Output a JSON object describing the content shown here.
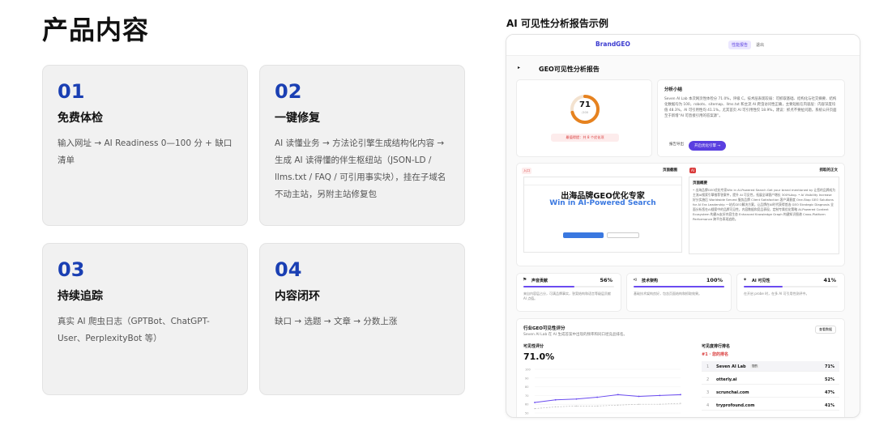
{
  "page_title": "产品内容",
  "cards": [
    {
      "num": "01",
      "title": "免费体检",
      "desc": "输入网址 → AI Readiness 0—100 分 + 缺口清单"
    },
    {
      "num": "02",
      "title": "一键修复",
      "desc": "AI 读懂业务 → 方法论引擎生成结构化内容 → 生成 AI 读得懂的伴生枢纽站（JSON-LD / llms.txt / FAQ / 可引用事实块），挂在子域名不动主站，另附主站修复包"
    },
    {
      "num": "03",
      "title": "持续追踪",
      "desc": "真实 AI 爬虫日志（GPTBot、ChatGPT-User、PerplexityBot 等）"
    },
    {
      "num": "04",
      "title": "内容闭环",
      "desc": "缺口 → 选题 → 文章 → 分数上涨"
    }
  ],
  "report": {
    "heading": "AI 可见性分析报告示例",
    "brand": "BrandGEO",
    "nav_btn1": "性能报告",
    "nav_btn2": "退出",
    "title": "GEO可见性分析报告",
    "score": "71",
    "score_sub": "/100",
    "score_badge": "最值得提：共 8 个优化项",
    "summary_title": "分析小结",
    "summary_text": "Seven AI Lab 本次网页性体检分 71.0%，评级 C。技术层表现较弱：可抓取基础、结构化与社交摘要、结构化数据均为 100，robots、sitemap、llms.txt 和主流 AI 爬虫访问性正确，主要短板在内容层：内容深度均值 48.3%，AI 可引用性均 41.1%，尤其首页 AI 可引用性仅 18.9%，建议：抓点不要扯问题，系统公开页面至于新增“AI 可直接引用的答案源”。",
    "btn_secondary": "报告导出",
    "btn_primary": "开启优化引擎 →",
    "preview_label_l": "页面截图",
    "preview_label_r": "抓取的正文",
    "tag_l": "入口",
    "tag_r": "AI",
    "hero_line1": "出海品牌GEO优化专家",
    "hero_line2": "Win in AI-Powered Search",
    "page_summary_title": "页面概要",
    "page_summary_text": "• 出海品牌GEO优化专家Win in AI-Powered Search Get your brand mentioned by 让您的品牌成为主流AI搜索引擎推荐答案中，提升 AI 可见性，拓展全球客户增长 300%Avg. • AI Visibility Increase 好分实施后 Worldwide Served 服务品牌 Client Satisfaction 客户满意度 One-Stop GEO Solutions for AI Era Leadership 一站式GEO解决方案，让品牌在AI时代获得首选 GEO Strategic Diagnosis 全面分析您在AI搜索中的品牌可见性，内容数据和竞品表现，定制专属优化策略 AI-Powered Content Ecosystem 构建AI友好内容生态 Enhanced Knowledge Graph 构建知识图谱 Cross-Platform Performance 跨平台表现追踪。",
    "metrics": [
      {
        "icon": "⚑",
        "label": "声音贡献",
        "value": "56%",
        "fill": 0.56,
        "desc": "来自内容层占分，可满品牌事实，答案结构和语言等级层贡献 AI 点值。"
      },
      {
        "icon": "⊲",
        "label": "技术架构",
        "value": "100%",
        "fill": 1.0,
        "desc": "基础技术架构良好，包含页面结构和抓取效果。"
      },
      {
        "icon": "✦",
        "label": "AI 可见性",
        "value": "41%",
        "fill": 0.41,
        "desc": "在开启 probe 时，在多 AI 可引用性测评中。"
      }
    ],
    "industry_title": "行业GEO可见性评分",
    "industry_desc": "Seven AI Lab 在 AI 生成答案中出现的频率和同口径竞品排名。",
    "industry_btn": "查看数据",
    "score_label": "可见性评分",
    "score_value": "71.0%",
    "rank_title": "可见度排行排名",
    "rank_sub": "#1 · 您的排名",
    "ranking": [
      {
        "pos": "1",
        "name": "Seven AI Lab",
        "tag": "您的",
        "pct": "71%"
      },
      {
        "pos": "2",
        "name": "otterly.ai",
        "tag": "",
        "pct": "52%"
      },
      {
        "pos": "3",
        "name": "scrunchai.com",
        "tag": "",
        "pct": "47%"
      },
      {
        "pos": "4",
        "name": "tryprofound.com",
        "tag": "",
        "pct": "41%"
      }
    ],
    "colors": {
      "accent": "#1a3fb3",
      "purple": "#6a4bf0",
      "score_ring": "#e6821f",
      "red": "#d93a3a"
    }
  },
  "chart_data": {
    "type": "line",
    "ylim": [
      50,
      100
    ],
    "yticks": [
      "100",
      "90",
      "80",
      "70",
      "60",
      "50"
    ],
    "series": [
      {
        "name": "",
        "values": [
          62,
          65,
          66,
          68,
          71,
          69,
          70,
          71
        ]
      },
      {
        "name": "",
        "values": [
          55,
          57,
          58,
          58,
          59,
          60,
          60,
          61
        ]
      }
    ]
  }
}
